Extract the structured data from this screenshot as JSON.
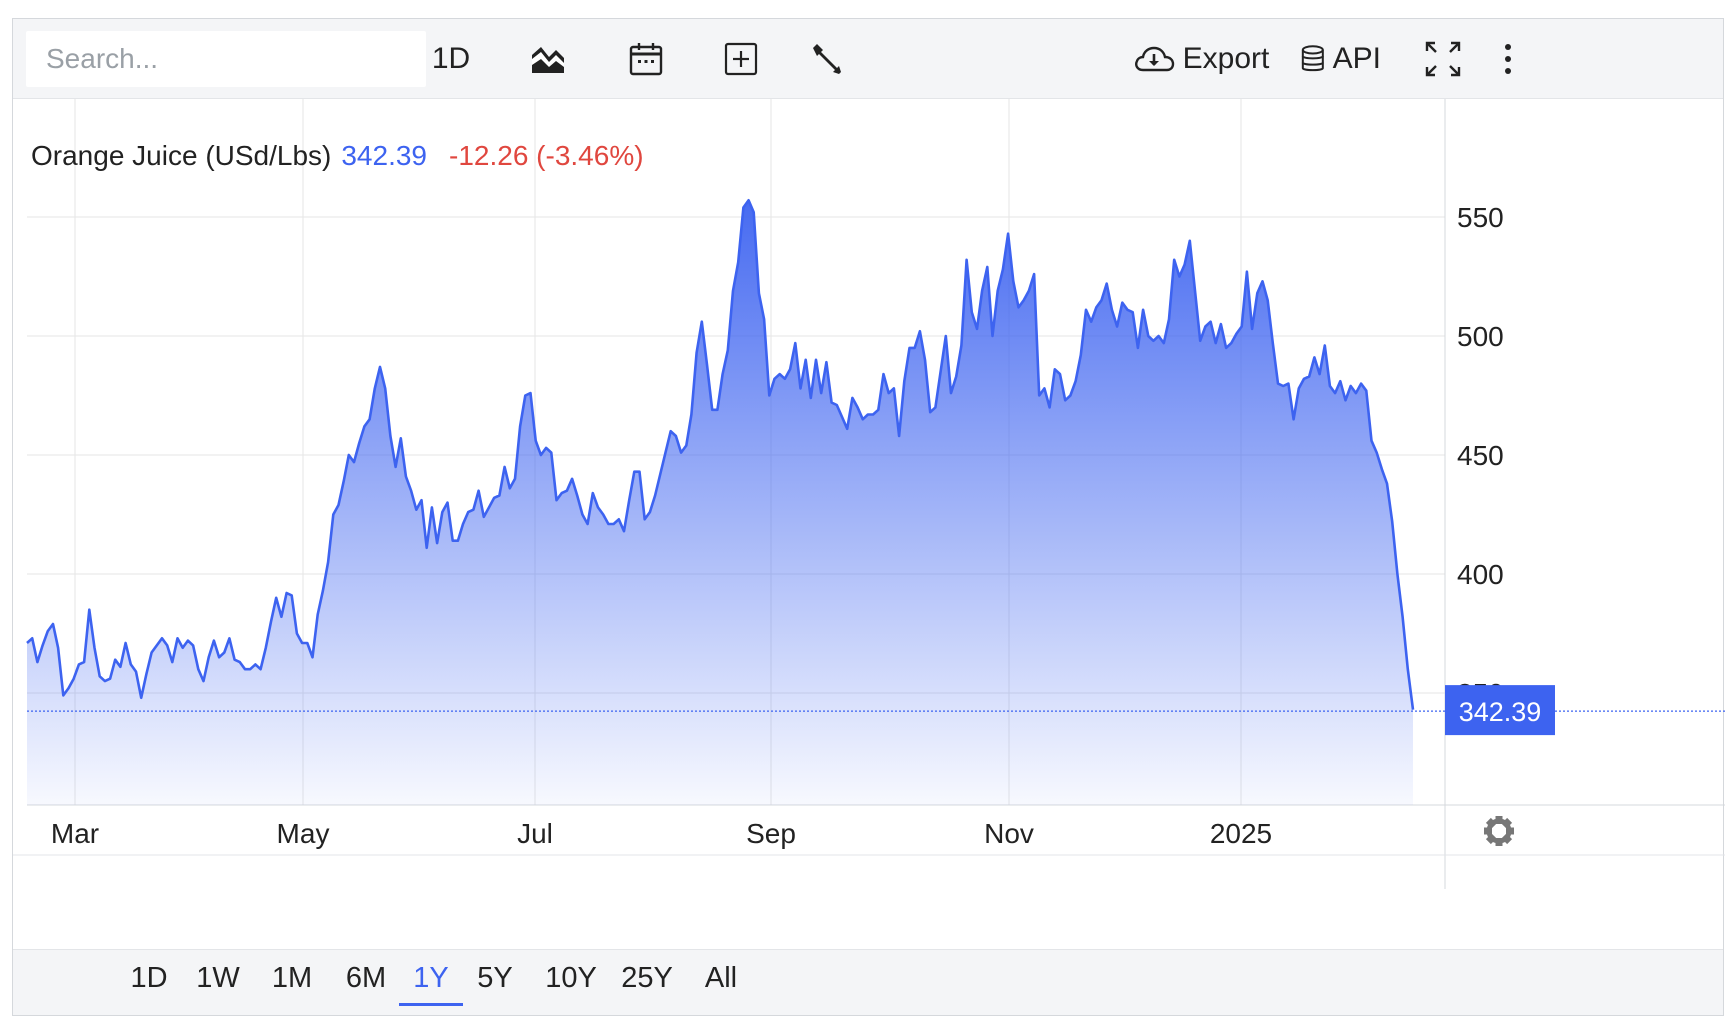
{
  "toolbar": {
    "search_placeholder": "Search...",
    "interval_label": "1D",
    "export_label": "Export",
    "api_label": "API",
    "icons": [
      "chart-type-icon",
      "calendar-icon",
      "add-indicator-icon",
      "wrench-icon",
      "cloud-download-icon",
      "database-icon",
      "fullscreen-icon",
      "more-vertical-icon"
    ]
  },
  "legend": {
    "name": "Orange Juice (USd/Lbs)",
    "price": "342.39",
    "change": "-12.26 (-3.46%)"
  },
  "colors": {
    "line": "#3d63f0",
    "price_text": "#3d63f0",
    "change_text": "#e0473f",
    "fill_top": "#3d63f0",
    "grid": "#e6e6e6"
  },
  "range_buttons": [
    "1D",
    "1W",
    "1M",
    "6M",
    "1Y",
    "5Y",
    "10Y",
    "25Y",
    "All"
  ],
  "range_active": "1Y",
  "chart_data": {
    "type": "area",
    "x_tick_labels": [
      "Mar",
      "May",
      "Jul",
      "Sep",
      "Nov",
      "2025"
    ],
    "y_tick_labels": [
      "350",
      "400",
      "450",
      "500",
      "550"
    ],
    "ylim": [
      300,
      590
    ],
    "last_value_label": "342.39",
    "last_value": 342.39,
    "grid": true,
    "series": [
      {
        "values": [
          371,
          373,
          363,
          370,
          376,
          379,
          369,
          349,
          352,
          356,
          362,
          363,
          385,
          369,
          357,
          355,
          356,
          364,
          361,
          371,
          362,
          359,
          348,
          358,
          367,
          370,
          373,
          370,
          363,
          373,
          369,
          372,
          370,
          360,
          355,
          365,
          372,
          365,
          367,
          373,
          364,
          363,
          360,
          360,
          362,
          360,
          369,
          380,
          390,
          382,
          392,
          391,
          375,
          371,
          371,
          365,
          383,
          393,
          405,
          425,
          429,
          439,
          450,
          447,
          455,
          462,
          465,
          478,
          487,
          478,
          458,
          445,
          457,
          441,
          435,
          427,
          431,
          411,
          428,
          413,
          426,
          430,
          414,
          414,
          421,
          426,
          427,
          435,
          424,
          428,
          432,
          433,
          445,
          436,
          440,
          462,
          475,
          476,
          456,
          450,
          453,
          451,
          431,
          434,
          435,
          440,
          433,
          425,
          421,
          434,
          428,
          425,
          421,
          421,
          423,
          418,
          431,
          443,
          443,
          423,
          426,
          433,
          442,
          451,
          460,
          458,
          451,
          454,
          467,
          493,
          506,
          488,
          469,
          469,
          484,
          494,
          519,
          531,
          554,
          557,
          552,
          518,
          507,
          475,
          482,
          484,
          482,
          486,
          497,
          478,
          490,
          474,
          490,
          476,
          489,
          472,
          471,
          466,
          461,
          474,
          470,
          465,
          467,
          467,
          469,
          484,
          476,
          478,
          458,
          481,
          495,
          495,
          502,
          490,
          468,
          470,
          485,
          500,
          476,
          483,
          496,
          532,
          510,
          503,
          519,
          529,
          500,
          519,
          528,
          543,
          523,
          512,
          515,
          519,
          526,
          475,
          478,
          470,
          486,
          484,
          473,
          475,
          481,
          492,
          511,
          506,
          512,
          515,
          522,
          511,
          504,
          514,
          511,
          510,
          495,
          511,
          500,
          498,
          500,
          497,
          507,
          532,
          525,
          530,
          540,
          519,
          498,
          504,
          506,
          497,
          505,
          495,
          497,
          501,
          504,
          527,
          503,
          518,
          523,
          515,
          497,
          480,
          479,
          480,
          465,
          478,
          482,
          483,
          491,
          484,
          496,
          479,
          476,
          481,
          473,
          479,
          476,
          480,
          477,
          456,
          451,
          444,
          438,
          422,
          400,
          382,
          360,
          343
        ]
      }
    ]
  }
}
